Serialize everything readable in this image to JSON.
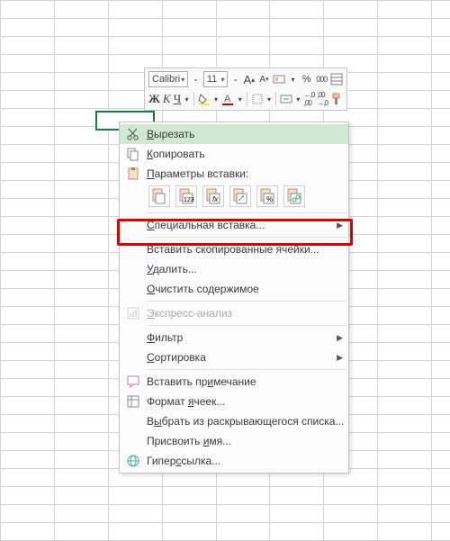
{
  "toolbar": {
    "font_name": "Calibri",
    "font_size": "11",
    "increase_font": "A",
    "decrease_font": "A",
    "percent": "%",
    "thousands": "000",
    "bold": "Ж",
    "italic": "К",
    "inc_dec_left": ",00",
    "inc_dec_right": ",0"
  },
  "menu": {
    "cut": "Вырезать",
    "copy": "Копировать",
    "paste_options_title": "Параметры вставки:",
    "paste_special": "Специальная вставка...",
    "insert_copied": "Вставить скопированные ячейки...",
    "delete": "Удалить...",
    "clear": "Очистить содержимое",
    "quick_analysis": "Экспресс-анализ",
    "filter": "Фильтр",
    "sort": "Сортировка",
    "insert_comment": "Вставить примечание",
    "format_cells": "Формат ячеек...",
    "pick_from_list": "Выбрать из раскрывающегося списка...",
    "define_name": "Присвоить имя...",
    "hyperlink": "Гиперссылка..."
  },
  "hotkey_underline": {
    "cut": "В",
    "copy": "К",
    "paste_opts": "П",
    "special": "С",
    "delete": "У",
    "clear": "О",
    "quick": "Э",
    "filter": "Ф",
    "sort": "С",
    "comment": "и",
    "format": "я",
    "pick": "ы",
    "name": "и",
    "link": "с"
  }
}
